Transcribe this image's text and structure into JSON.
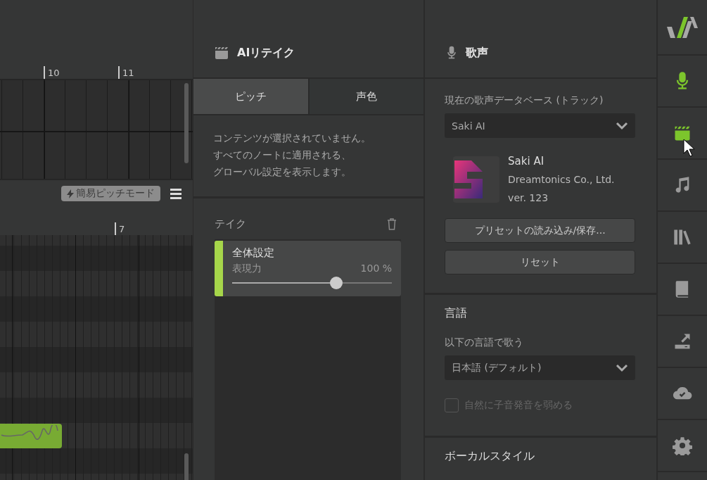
{
  "piano_roll": {
    "upper_ruler": [
      "10",
      "11"
    ],
    "mode_badge": "簡易ピッチモード",
    "lower_ruler": [
      "7"
    ]
  },
  "retake_panel": {
    "title": "AIリテイク",
    "tabs": [
      {
        "label": "ピッチ",
        "selected": true
      },
      {
        "label": "声色",
        "selected": false
      }
    ],
    "message_lines": [
      "コンテンツが選択されていません。",
      "すべてのノートに適用される、",
      "グローバル設定を表示します。"
    ],
    "takes_label": "テイク",
    "takes": [
      {
        "name": "全体設定",
        "param": "表現力",
        "reading": "100 %",
        "level": 0.65,
        "color": "#a6d64a"
      }
    ]
  },
  "voice_panel": {
    "title": "歌声",
    "database_label": "現在の歌声データベース (トラック)",
    "database_value": "Saki AI",
    "voicebank": {
      "name": "Saki AI",
      "vendor": "Dreamtonics Co., Ltd.",
      "version": "ver. 123"
    },
    "buttons": [
      "プリセットの読み込み/保存...",
      "リセット"
    ],
    "language_heading": "言語",
    "language_label": "以下の言語で歌う",
    "language_value": "日本語 (デフォルト)",
    "consonant": {
      "label": "自然に子音発音を弱める",
      "checked": false,
      "disabled": true
    },
    "style_heading": "ボーカルスタイル"
  },
  "sidebar": {
    "items": [
      {
        "kind": "logo"
      },
      {
        "kind": "mic",
        "selected": true
      },
      {
        "kind": "clapper",
        "selected": true
      },
      {
        "kind": "note",
        "selected": false
      },
      {
        "kind": "library",
        "selected": false
      },
      {
        "kind": "book",
        "selected": false
      },
      {
        "kind": "export",
        "selected": false
      },
      {
        "kind": "cloud",
        "selected": false
      },
      {
        "kind": "settings",
        "selected": false
      }
    ]
  }
}
